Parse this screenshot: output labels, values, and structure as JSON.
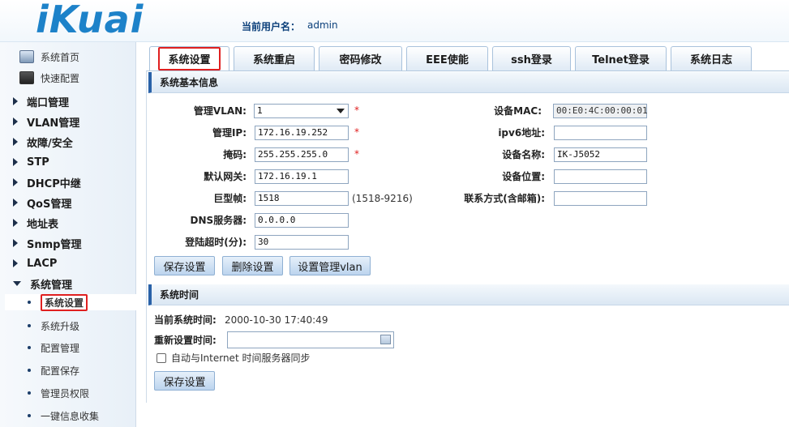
{
  "header": {
    "logo": "iKuai",
    "user_label": "当前用户名：",
    "user_name": "admin"
  },
  "sidebar": {
    "top_items": [
      {
        "label": "系统首页",
        "icon": "monitor-icon"
      },
      {
        "label": "快速配置",
        "icon": "quick-config-icon"
      }
    ],
    "menus": [
      {
        "label": "端口管理"
      },
      {
        "label": "VLAN管理"
      },
      {
        "label": "故障/安全"
      },
      {
        "label": "STP"
      },
      {
        "label": "DHCP中继"
      },
      {
        "label": "QoS管理"
      },
      {
        "label": "地址表"
      },
      {
        "label": "Snmp管理"
      },
      {
        "label": "LACP"
      },
      {
        "label": "系统管理",
        "expanded": true
      }
    ],
    "sub_items": [
      {
        "label": "系统设置",
        "active": true
      },
      {
        "label": "系统升级"
      },
      {
        "label": "配置管理"
      },
      {
        "label": "配置保存"
      },
      {
        "label": "管理员权限"
      },
      {
        "label": "一键信息收集"
      }
    ]
  },
  "tabs": [
    {
      "label": "系统设置",
      "active": true
    },
    {
      "label": "系统重启"
    },
    {
      "label": "密码修改"
    },
    {
      "label": "EEE使能"
    },
    {
      "label": "ssh登录"
    },
    {
      "label": "Telnet登录"
    },
    {
      "label": "系统日志"
    }
  ],
  "basic": {
    "title": "系统基本信息",
    "mgmt_vlan_label": "管理VLAN:",
    "mgmt_vlan_value": "1",
    "mgmt_ip_label": "管理IP:",
    "mgmt_ip_value": "172.16.19.252",
    "mask_label": "掩码:",
    "mask_value": "255.255.255.0",
    "gateway_label": "默认网关:",
    "gateway_value": "172.16.19.1",
    "jumbo_label": "巨型帧:",
    "jumbo_value": "1518",
    "jumbo_hint": "(1518-9216)",
    "dns_label": "DNS服务器:",
    "dns_value": "0.0.0.0",
    "timeout_label": "登陆超时(分):",
    "timeout_value": "30",
    "mac_label": "设备MAC:",
    "mac_value": "00:E0:4C:00:00:01",
    "ipv6_label": "ipv6地址:",
    "ipv6_value": "",
    "devname_label": "设备名称:",
    "devname_value": "IK-J5052",
    "location_label": "设备位置:",
    "location_value": "",
    "contact_label": "联系方式(含邮箱):",
    "contact_value": "",
    "required_mark": "*",
    "save_button": "保存设置",
    "delete_button": "删除设置",
    "set_vlan_button": "设置管理vlan"
  },
  "time": {
    "title": "系统时间",
    "current_label": "当前系统时间:",
    "current_value": "2000-10-30 17:40:49",
    "reset_label": "重新设置时间:",
    "reset_value": "",
    "sync_label": "自动与Internet 时间服务器同步",
    "sync_checked": false,
    "save_button": "保存设置"
  }
}
